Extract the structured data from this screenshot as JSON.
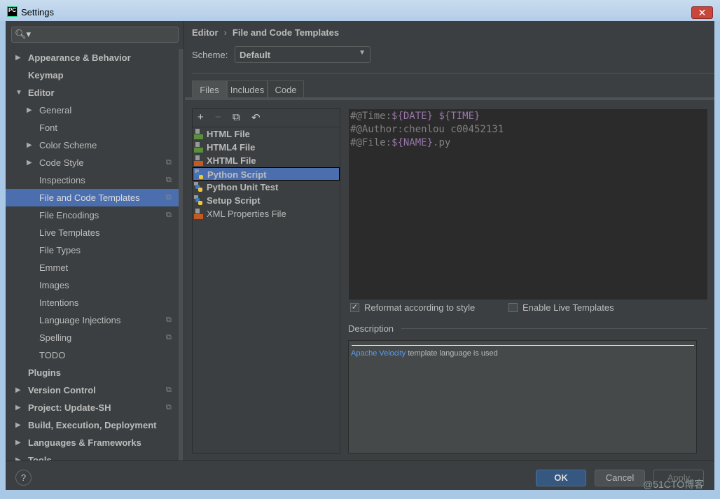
{
  "window": {
    "title": "Settings",
    "app_icon": "PC"
  },
  "search": {
    "placeholder": ""
  },
  "sidebar": {
    "items": [
      {
        "label": "Appearance & Behavior",
        "level": 0,
        "arrow": "right",
        "bold": true
      },
      {
        "label": "Keymap",
        "level": 0,
        "bold": true
      },
      {
        "label": "Editor",
        "level": 0,
        "arrow": "down",
        "bold": true
      },
      {
        "label": "General",
        "level": 1,
        "arrow": "right"
      },
      {
        "label": "Font",
        "level": 1
      },
      {
        "label": "Color Scheme",
        "level": 1,
        "arrow": "right"
      },
      {
        "label": "Code Style",
        "level": 1,
        "arrow": "right",
        "copy": true
      },
      {
        "label": "Inspections",
        "level": 1,
        "copy": true
      },
      {
        "label": "File and Code Templates",
        "level": 1,
        "copy": true,
        "selected": true
      },
      {
        "label": "File Encodings",
        "level": 1,
        "copy": true
      },
      {
        "label": "Live Templates",
        "level": 1
      },
      {
        "label": "File Types",
        "level": 1
      },
      {
        "label": "Emmet",
        "level": 1
      },
      {
        "label": "Images",
        "level": 1
      },
      {
        "label": "Intentions",
        "level": 1
      },
      {
        "label": "Language Injections",
        "level": 1,
        "copy": true
      },
      {
        "label": "Spelling",
        "level": 1,
        "copy": true
      },
      {
        "label": "TODO",
        "level": 1
      },
      {
        "label": "Plugins",
        "level": 0,
        "bold": true
      },
      {
        "label": "Version Control",
        "level": 0,
        "arrow": "right",
        "bold": true,
        "copy": true
      },
      {
        "label": "Project: Update-SH",
        "level": 0,
        "arrow": "right",
        "bold": true,
        "copy": true
      },
      {
        "label": "Build, Execution, Deployment",
        "level": 0,
        "arrow": "right",
        "bold": true
      },
      {
        "label": "Languages & Frameworks",
        "level": 0,
        "arrow": "right",
        "bold": true
      },
      {
        "label": "Tools",
        "level": 0,
        "arrow": "right",
        "bold": true
      }
    ]
  },
  "breadcrumb": {
    "parent": "Editor",
    "sep": "›",
    "current": "File and Code Templates"
  },
  "scheme": {
    "label": "Scheme:",
    "value": "Default"
  },
  "tabs": [
    {
      "label": "Files",
      "selected": true
    },
    {
      "label": "Includes"
    },
    {
      "label": "Code"
    }
  ],
  "toolbar": {
    "add": "+",
    "remove": "−",
    "copy": "⧉",
    "reset": "↶"
  },
  "files": [
    {
      "name": "HTML File",
      "bold": true,
      "icon": "html-file",
      "color": "#5a8f3c"
    },
    {
      "name": "HTML4 File",
      "bold": true,
      "icon": "html-file",
      "color": "#5a8f3c"
    },
    {
      "name": "XHTML File",
      "bold": true,
      "icon": "html-file",
      "color": "#c35a24"
    },
    {
      "name": "Python Script",
      "bold": true,
      "icon": "python",
      "selected": true
    },
    {
      "name": "Python Unit Test",
      "bold": true,
      "icon": "python"
    },
    {
      "name": "Setup Script",
      "bold": true,
      "icon": "python"
    },
    {
      "name": "XML Properties File",
      "bold": false,
      "icon": "xml-file",
      "color": "#c35a24"
    }
  ],
  "editor": {
    "lines": [
      [
        {
          "t": "#@Time:"
        },
        {
          "t": "${DATE}",
          "v": true
        },
        {
          "t": " "
        },
        {
          "t": "${TIME}",
          "v": true
        }
      ],
      [
        {
          "t": "#@Author:chenlou c00452131"
        }
      ],
      [
        {
          "t": "#@File:"
        },
        {
          "t": "${NAME}",
          "v": true
        },
        {
          "t": ".py"
        }
      ]
    ]
  },
  "options": {
    "reformat": {
      "label": "Reformat according to style",
      "checked": true
    },
    "live": {
      "label": "Enable Live Templates",
      "checked": false
    }
  },
  "description": {
    "label": "Description",
    "link": "Apache Velocity",
    "text": " template language is used"
  },
  "buttons": {
    "help": "?",
    "ok": "OK",
    "cancel": "Cancel",
    "apply": "Apply"
  },
  "watermark": "@51CTO博客",
  "colors": {
    "accent": "#4b6eaf",
    "bg": "#3c3f41",
    "editor_bg": "#2b2b2b",
    "var": "#9876aa",
    "link": "#589df6"
  }
}
